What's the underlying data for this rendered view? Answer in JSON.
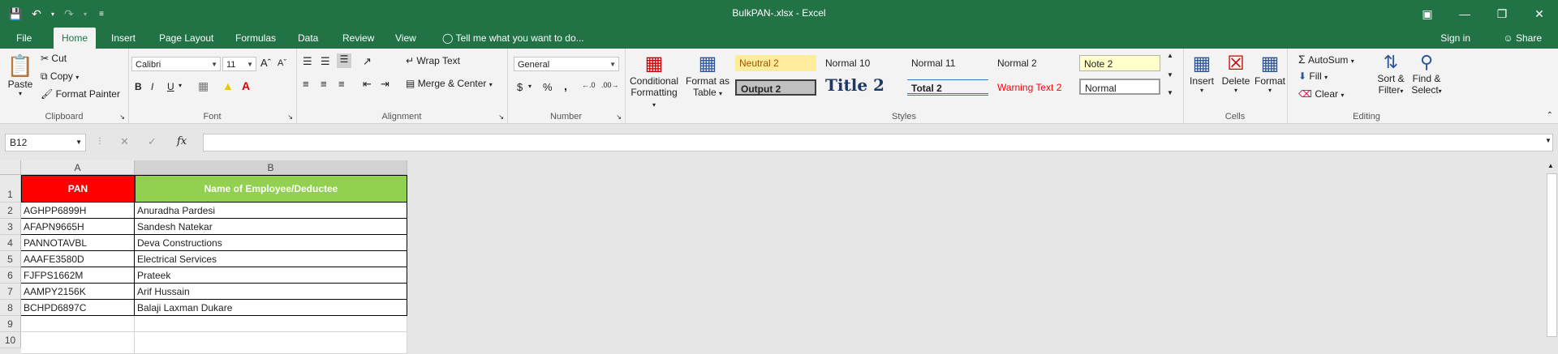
{
  "window": {
    "title": "BulkPAN-.xlsx - Excel"
  },
  "tabs": [
    "File",
    "Home",
    "Insert",
    "Page Layout",
    "Formulas",
    "Data",
    "Review",
    "View"
  ],
  "active_tab": "Home",
  "tell_me": "Tell me what you want to do...",
  "account": {
    "signin": "Sign in",
    "share": "Share"
  },
  "clipboard": {
    "paste": "Paste",
    "cut": "Cut",
    "copy": "Copy",
    "format_painter": "Format Painter",
    "label": "Clipboard"
  },
  "font": {
    "name": "Calibri",
    "size": "11",
    "bold": "B",
    "italic": "I",
    "underline": "U",
    "label": "Font"
  },
  "alignment": {
    "wrap_text": "Wrap Text",
    "merge_center": "Merge & Center",
    "label": "Alignment"
  },
  "number": {
    "format": "General",
    "currency": "$",
    "percent": "%",
    "comma": ",",
    "label": "Number"
  },
  "styles_group": {
    "conditional": "Conditional",
    "conditional2": "Formatting",
    "format_as": "Format as",
    "format_as2": "Table",
    "label": "Styles",
    "cells": [
      "Neutral 2",
      "Normal 10",
      "Normal 11",
      "Normal 2",
      "Note 2",
      "Output 2",
      "Title 2",
      "Total 2",
      "Warning Text 2",
      "Normal"
    ]
  },
  "cells_group": {
    "insert": "Insert",
    "delete": "Delete",
    "format": "Format",
    "label": "Cells"
  },
  "editing": {
    "autosum": "AutoSum",
    "fill": "Fill",
    "clear": "Clear",
    "sort": "Sort &",
    "sort2": "Filter",
    "find": "Find &",
    "find2": "Select",
    "label": "Editing"
  },
  "formula_bar": {
    "name_box": "B12",
    "fx": "fx",
    "value": ""
  },
  "sheet": {
    "columns": [
      "A",
      "B"
    ],
    "row_numbers": [
      "1",
      "2",
      "3",
      "4",
      "5",
      "6",
      "7",
      "8",
      "9",
      "10"
    ],
    "header": {
      "pan": "PAN",
      "name": "Name of Employee/Deductee"
    },
    "rows": [
      {
        "pan": "AGHPP6899H",
        "name": "Anuradha Pardesi"
      },
      {
        "pan": "AFAPN9665H",
        "name": "Sandesh Natekar"
      },
      {
        "pan": "PANNOTAVBL",
        "name": "Deva Constructions"
      },
      {
        "pan": "AAAFE3580D",
        "name": "Electrical Services"
      },
      {
        "pan": "FJFPS1662M",
        "name": "Prateek"
      },
      {
        "pan": "AAMPY2156K",
        "name": "Arif Hussain"
      },
      {
        "pan": "BCHPD6897C",
        "name": "Balaji Laxman Dukare"
      }
    ],
    "colors": {
      "pan_header": "#ff0000",
      "name_header": "#92d050"
    }
  }
}
